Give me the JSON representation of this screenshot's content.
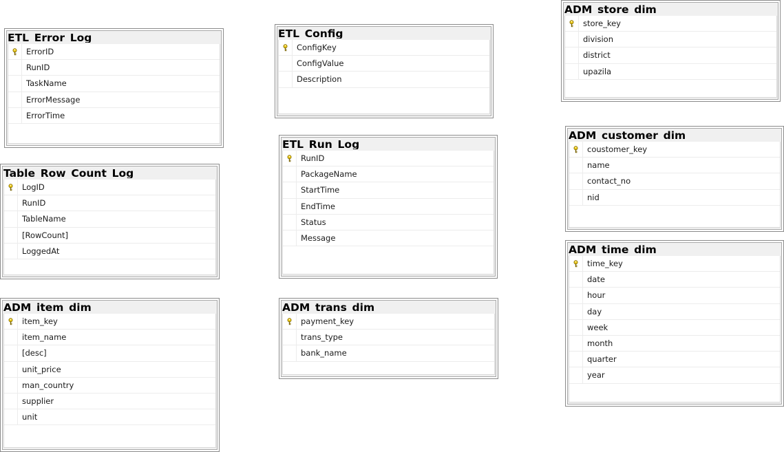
{
  "tables": {
    "etl_error_log": {
      "name": "ETL_Error_Log",
      "columns": [
        {
          "name": "ErrorID",
          "pk": true
        },
        {
          "name": "RunID",
          "pk": false
        },
        {
          "name": "TaskName",
          "pk": false
        },
        {
          "name": "ErrorMessage",
          "pk": false
        },
        {
          "name": "ErrorTime",
          "pk": false
        }
      ]
    },
    "etl_config": {
      "name": "ETL_Config",
      "columns": [
        {
          "name": "ConfigKey",
          "pk": true
        },
        {
          "name": "ConfigValue",
          "pk": false
        },
        {
          "name": "Description",
          "pk": false
        }
      ]
    },
    "adm_store_dim": {
      "name": "ADM_store_dim",
      "columns": [
        {
          "name": "store_key",
          "pk": true
        },
        {
          "name": "division",
          "pk": false
        },
        {
          "name": "district",
          "pk": false
        },
        {
          "name": "upazila",
          "pk": false
        }
      ]
    },
    "etl_run_log": {
      "name": "ETL_Run_Log",
      "columns": [
        {
          "name": "RunID",
          "pk": true
        },
        {
          "name": "PackageName",
          "pk": false
        },
        {
          "name": "StartTime",
          "pk": false
        },
        {
          "name": "EndTime",
          "pk": false
        },
        {
          "name": "Status",
          "pk": false
        },
        {
          "name": "Message",
          "pk": false
        }
      ]
    },
    "adm_customer_dim": {
      "name": "ADM_customer_dim",
      "columns": [
        {
          "name": "coustomer_key",
          "pk": true
        },
        {
          "name": "name",
          "pk": false
        },
        {
          "name": "contact_no",
          "pk": false
        },
        {
          "name": "nid",
          "pk": false
        }
      ]
    },
    "table_row_count_log": {
      "name": "Table_Row_Count_Log",
      "columns": [
        {
          "name": "LogID",
          "pk": true
        },
        {
          "name": "RunID",
          "pk": false
        },
        {
          "name": "TableName",
          "pk": false
        },
        {
          "name": "[RowCount]",
          "pk": false
        },
        {
          "name": "LoggedAt",
          "pk": false
        }
      ]
    },
    "adm_time_dim": {
      "name": "ADM_time_dim",
      "columns": [
        {
          "name": "time_key",
          "pk": true
        },
        {
          "name": "date",
          "pk": false
        },
        {
          "name": "hour",
          "pk": false
        },
        {
          "name": "day",
          "pk": false
        },
        {
          "name": "week",
          "pk": false
        },
        {
          "name": "month",
          "pk": false
        },
        {
          "name": "quarter",
          "pk": false
        },
        {
          "name": "year",
          "pk": false
        }
      ]
    },
    "adm_item_dim": {
      "name": "ADM_item_dim",
      "columns": [
        {
          "name": "item_key",
          "pk": true
        },
        {
          "name": "item_name",
          "pk": false
        },
        {
          "name": "[desc]",
          "pk": false
        },
        {
          "name": "unit_price",
          "pk": false
        },
        {
          "name": "man_country",
          "pk": false
        },
        {
          "name": "supplier",
          "pk": false
        },
        {
          "name": "unit",
          "pk": false
        }
      ]
    },
    "adm_trans_dim": {
      "name": "ADM_trans_dim",
      "columns": [
        {
          "name": "payment_key",
          "pk": true
        },
        {
          "name": "trans_type",
          "pk": false
        },
        {
          "name": "bank_name",
          "pk": false
        }
      ]
    }
  },
  "colors": {
    "key_icon": "#e8c200",
    "title_bg": "#f0f0f0",
    "border": "#8a8a8a"
  }
}
